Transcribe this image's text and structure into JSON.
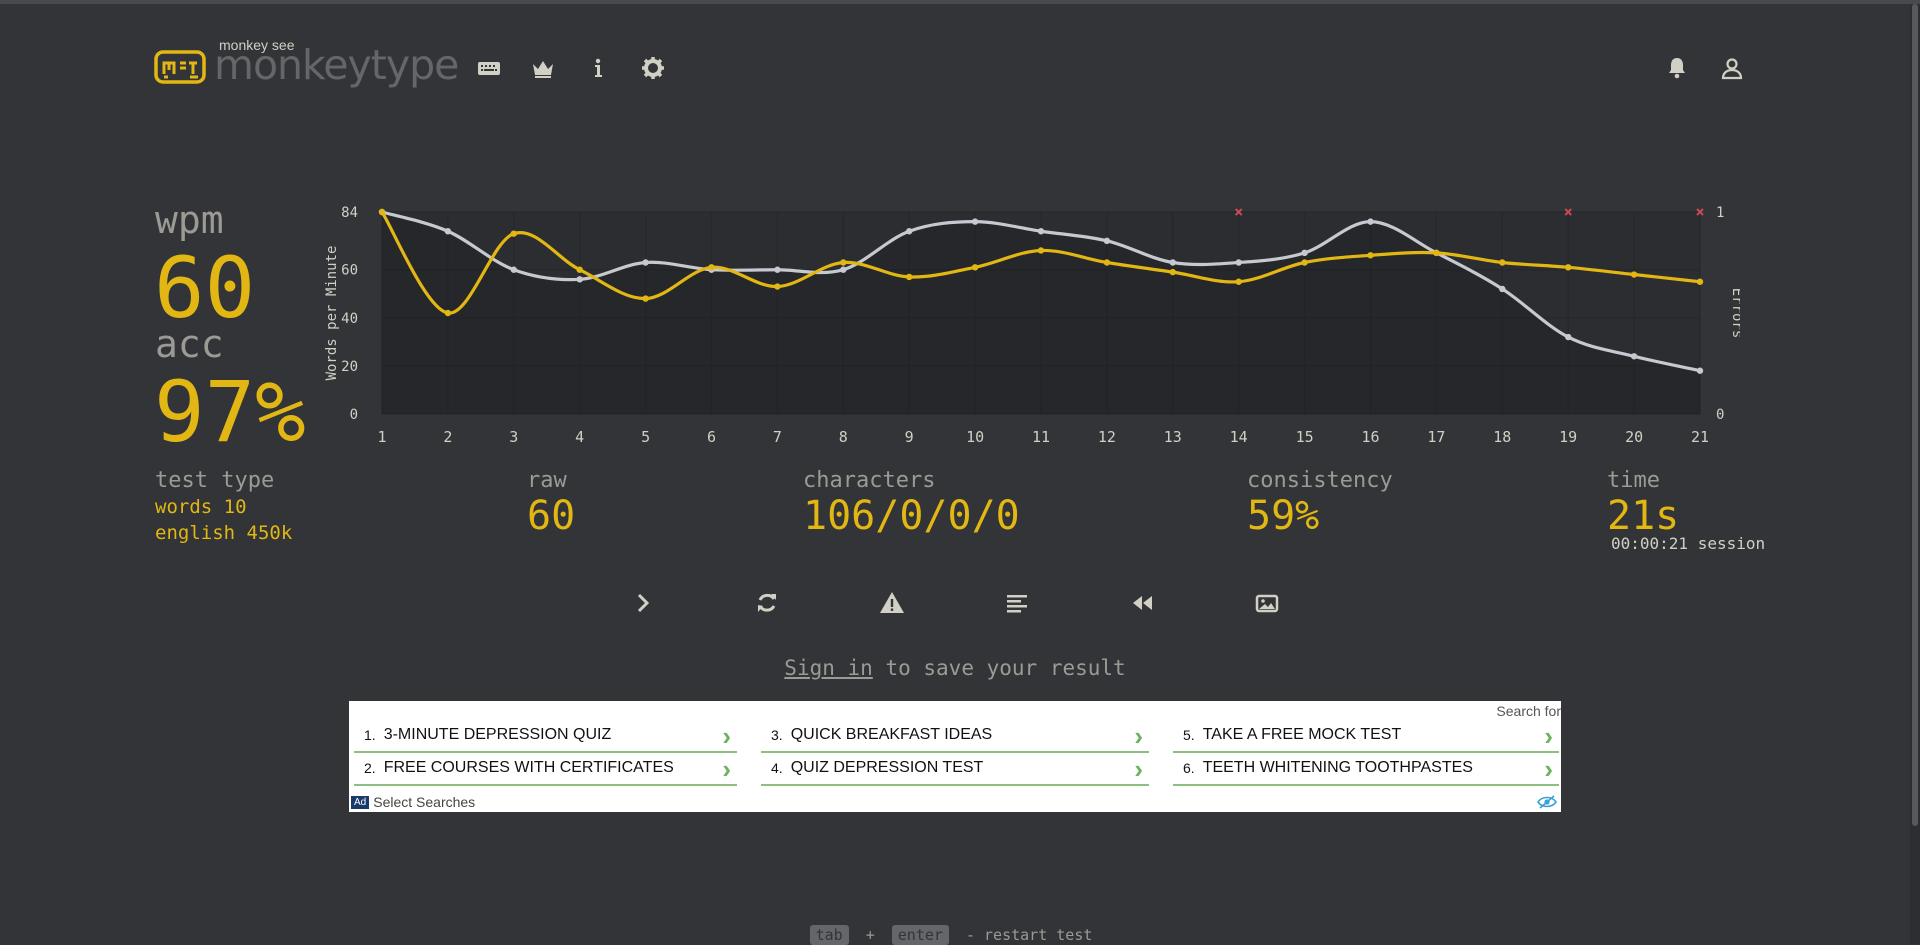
{
  "header": {
    "brand_sub": "monkey see",
    "brand": "monkeytype",
    "nav": [
      "keyboard-icon",
      "crown-icon",
      "info-icon",
      "gear-icon"
    ],
    "right": [
      "bell-icon",
      "user-icon"
    ]
  },
  "stats": {
    "wpm_label": "wpm",
    "wpm": "60",
    "acc_label": "acc",
    "acc": "97%",
    "test_type_label": "test type",
    "test_type_line1": "words 10",
    "test_type_line2": "english 450k",
    "raw_label": "raw",
    "raw": "60",
    "characters_label": "characters",
    "characters": "106/0/0/0",
    "consistency_label": "consistency",
    "consistency": "59%",
    "time_label": "time",
    "time": "21s",
    "session": "00:00:21 session"
  },
  "chart_data": {
    "type": "line",
    "x": [
      1,
      2,
      3,
      4,
      5,
      6,
      7,
      8,
      9,
      10,
      11,
      12,
      13,
      14,
      15,
      16,
      17,
      18,
      19,
      20,
      21
    ],
    "series": [
      {
        "values": [
          84,
          42,
          75,
          60,
          48,
          61,
          53,
          63,
          57,
          61,
          68,
          63,
          59,
          55,
          63,
          66,
          67,
          63,
          61,
          58,
          55
        ]
      },
      {
        "values": [
          84,
          76,
          60,
          56,
          63,
          60,
          60,
          60,
          76,
          80,
          76,
          72,
          63,
          63,
          67,
          80,
          67,
          52,
          32,
          24,
          18
        ]
      }
    ],
    "errors_x": [
      14,
      19,
      21
    ],
    "ylabel": "Words per Minute",
    "y2label": "Errors",
    "yticks": [
      0,
      20,
      40,
      60,
      84
    ],
    "y2ticks": [
      0,
      1
    ],
    "ylim": [
      0,
      84
    ],
    "colors": {
      "wpm": "#e2b714",
      "raw": "#c7c9d1",
      "error": "#ca4754"
    },
    "grid": true
  },
  "actions": [
    "next-test",
    "restart",
    "report",
    "words-history",
    "replay",
    "screenshot"
  ],
  "signin": {
    "link": "Sign in",
    "rest": " to save your result"
  },
  "ad": {
    "search_for": "Search for",
    "items": [
      {
        "num": "1.",
        "text": "3-Minute Depression Quiz"
      },
      {
        "num": "2.",
        "text": "Free Courses With Certificates"
      },
      {
        "num": "3.",
        "text": "Quick Breakfast Ideas"
      },
      {
        "num": "4.",
        "text": "Quiz Depression Test"
      },
      {
        "num": "5.",
        "text": "Take a Free Mock Test"
      },
      {
        "num": "6.",
        "text": "Teeth Whitening Toothpastes"
      }
    ],
    "badge": "Ad",
    "footer": "Select Searches"
  },
  "footer": {
    "key1": "tab",
    "plus": "+",
    "key2": "enter",
    "hint": "- restart test"
  }
}
